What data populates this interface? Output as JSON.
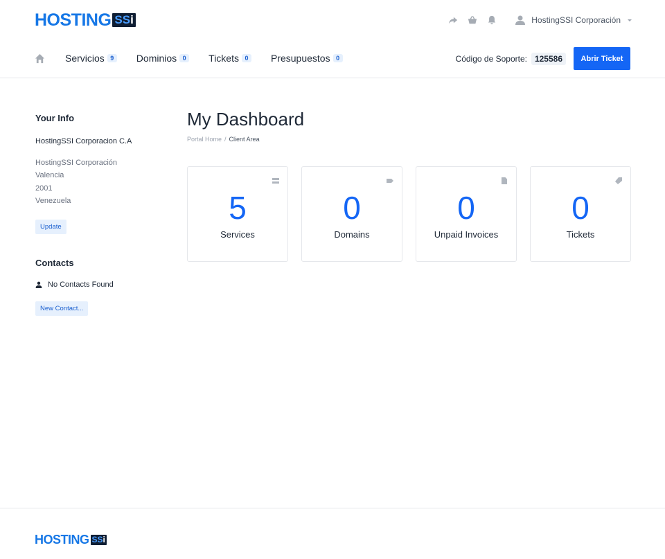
{
  "brand": {
    "word": "HOSTING",
    "box_ss": "SS",
    "box_i": "i"
  },
  "topbar": {
    "icons": [
      "share-icon",
      "basket-icon",
      "bell-icon"
    ],
    "user_name": "HostingSSI Corporación"
  },
  "nav": {
    "items": [
      {
        "label": "Servicios",
        "badge": "9"
      },
      {
        "label": "Dominios",
        "badge": "0"
      },
      {
        "label": "Tickets",
        "badge": "0"
      },
      {
        "label": "Presupuestos",
        "badge": "0"
      }
    ],
    "support_label": "Código de Soporte:",
    "support_code": "125586",
    "open_ticket": "Abrir Ticket"
  },
  "sidebar": {
    "info_title": "Your Info",
    "company": "HostingSSI Corporacion C.A",
    "address": [
      "HostingSSI Corporación",
      "Valencia",
      "2001",
      "Venezuela"
    ],
    "update_label": "Update",
    "contacts_title": "Contacts",
    "no_contacts": "No Contacts Found",
    "new_contact_label": "New Contact..."
  },
  "main": {
    "title": "My Dashboard",
    "breadcrumb": {
      "home": "Portal Home",
      "sep": "/",
      "current": "Client Area"
    },
    "tiles": [
      {
        "value": "5",
        "label": "Services",
        "icon": "server-icon"
      },
      {
        "value": "0",
        "label": "Domains",
        "icon": "tag-icon"
      },
      {
        "value": "0",
        "label": "Unpaid Invoices",
        "icon": "document-icon"
      },
      {
        "value": "0",
        "label": "Tickets",
        "icon": "ticket-icon"
      }
    ]
  },
  "colors": {
    "accent": "#1466f5",
    "brand": "#1677e6",
    "badge_bg": "#e6f0fd"
  }
}
